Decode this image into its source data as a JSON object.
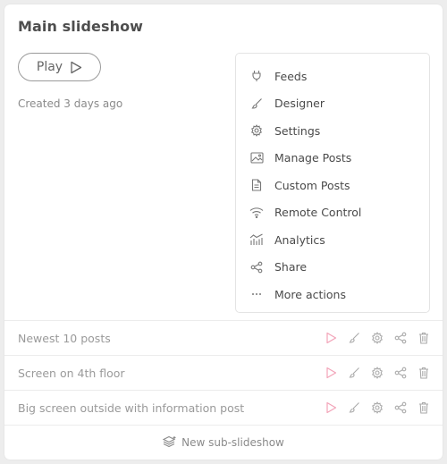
{
  "card": {
    "title": "Main slideshow",
    "play_label": "Play",
    "created": "Created 3 days ago"
  },
  "menu": {
    "items": [
      {
        "label": "Feeds",
        "icon": "plug-icon"
      },
      {
        "label": "Designer",
        "icon": "brush-icon"
      },
      {
        "label": "Settings",
        "icon": "gear-icon"
      },
      {
        "label": "Manage Posts",
        "icon": "image-icon"
      },
      {
        "label": "Custom Posts",
        "icon": "document-icon"
      },
      {
        "label": "Remote Control",
        "icon": "wifi-icon"
      },
      {
        "label": "Analytics",
        "icon": "analytics-icon"
      },
      {
        "label": "Share",
        "icon": "share-icon"
      },
      {
        "label": "More actions",
        "icon": "ellipsis-icon"
      }
    ]
  },
  "sub_slideshows": [
    {
      "label": "Newest 10 posts"
    },
    {
      "label": "Screen on 4th floor"
    },
    {
      "label": "Big screen outside with information post"
    }
  ],
  "footer": {
    "new_label": "New sub-slideshow",
    "icon": "stack-add-icon"
  },
  "colors": {
    "play_accent": "#f2a3b8",
    "icon_gray": "#9a9a9a"
  }
}
